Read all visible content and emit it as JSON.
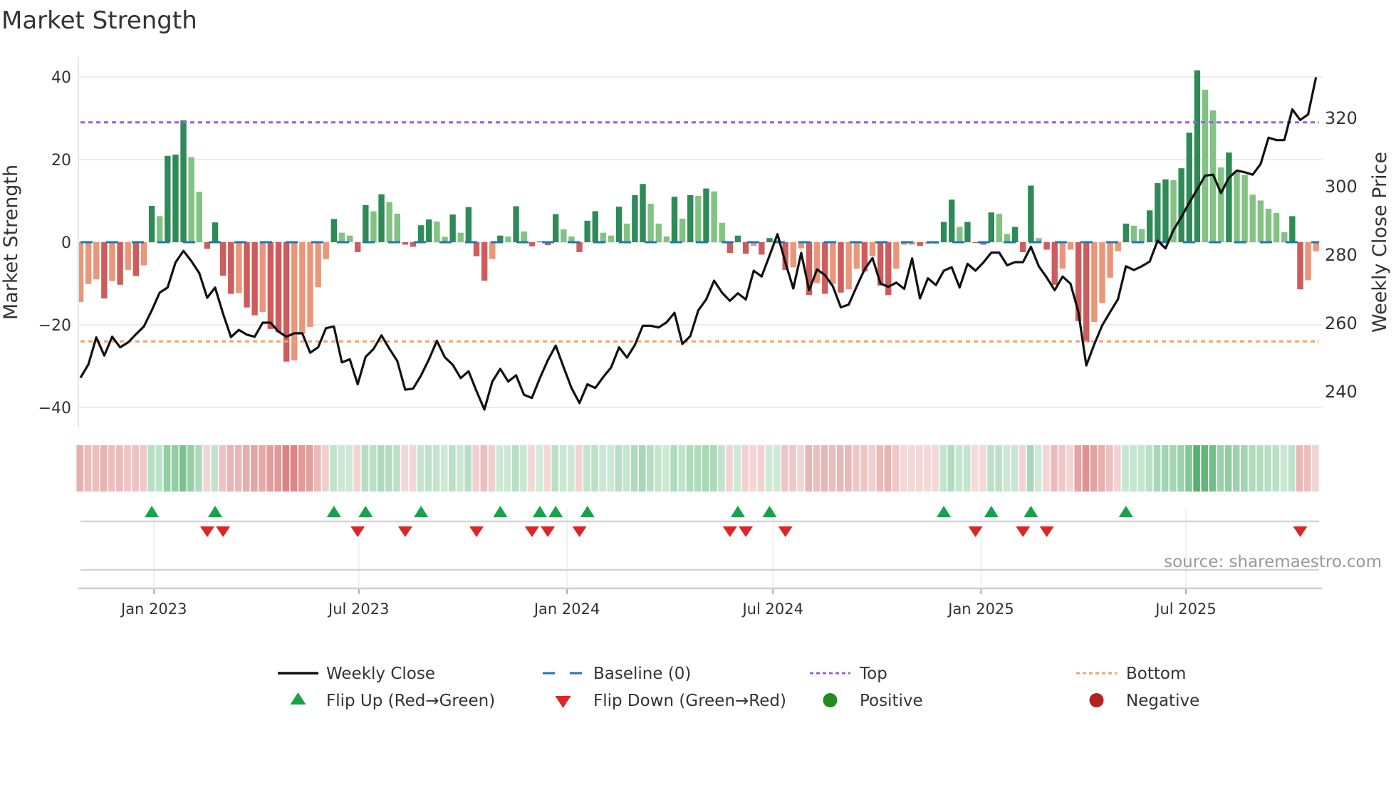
{
  "chart_data": {
    "type": "bar+line",
    "title": "Market Strength",
    "ylabel": "Market Strength",
    "y2label": "Weekly Close Price",
    "ylim": [
      -45,
      45
    ],
    "y2lim": [
      229.4,
      337.7
    ],
    "yticks": [
      {
        "value": 40,
        "label": "40"
      },
      {
        "value": 20,
        "label": "20"
      },
      {
        "value": 0,
        "label": "0"
      },
      {
        "value": -20,
        "label": "−20"
      },
      {
        "value": -40,
        "label": "−40"
      }
    ],
    "y2ticks": [
      {
        "value": 320,
        "label": "320"
      },
      {
        "value": 300,
        "label": "300"
      },
      {
        "value": 280,
        "label": "280"
      },
      {
        "value": 260,
        "label": "260"
      },
      {
        "value": 240,
        "label": "240"
      }
    ],
    "start_date": "2022-10-28",
    "frequency": "weekly",
    "xticks": [
      {
        "date": "2023-01-01",
        "label": "Jan 2023"
      },
      {
        "date": "2023-07-01",
        "label": "Jul 2023"
      },
      {
        "date": "2024-01-01",
        "label": "Jan 2024"
      },
      {
        "date": "2024-07-01",
        "label": "Jul 2024"
      },
      {
        "date": "2025-01-01",
        "label": "Jan 2025"
      },
      {
        "date": "2025-07-01",
        "label": "Jul 2025"
      }
    ],
    "top_level": 29,
    "bottom_level": -24,
    "baseline": 0,
    "strength": [
      -14.5,
      -10.1,
      -9.0,
      -13.6,
      -9.4,
      -10.3,
      -6.7,
      -8.2,
      -5.6,
      8.8,
      6.3,
      20.9,
      21.2,
      29.5,
      20.6,
      12.2,
      -1.6,
      4.8,
      -8.1,
      -12.5,
      -12.3,
      -15.8,
      -17.7,
      -16.9,
      -21.0,
      -21.8,
      -28.9,
      -28.6,
      -22.2,
      -20.5,
      -10.9,
      -4.1,
      5.6,
      2.3,
      1.6,
      -2.4,
      9.0,
      7.5,
      11.6,
      9.7,
      6.9,
      -0.6,
      -1.1,
      4.1,
      5.5,
      5.0,
      1.3,
      6.7,
      2.3,
      8.5,
      -3.4,
      -9.3,
      -4.1,
      1.6,
      1.4,
      8.7,
      2.6,
      -1.0,
      0.2,
      -0.7,
      6.8,
      3.1,
      1.4,
      -2.4,
      5.2,
      7.5,
      2.3,
      1.6,
      8.6,
      4.5,
      11.4,
      14.1,
      9.3,
      4.5,
      1.4,
      11.0,
      5.7,
      11.4,
      11.2,
      13.0,
      12.3,
      4.7,
      -2.6,
      1.6,
      -2.8,
      -0.9,
      -3.0,
      1.0,
      0.5,
      -6.7,
      -6.1,
      -1.5,
      -12.8,
      -9.9,
      -12.5,
      -10.1,
      -12.2,
      -11.4,
      -6.4,
      -7.1,
      -3.4,
      -10.5,
      -12.8,
      -6.4,
      -0.6,
      -0.6,
      -0.9,
      -0.4,
      -0.4,
      4.9,
      10.3,
      3.7,
      4.9,
      -0.2,
      -0.6,
      7.2,
      6.9,
      2.0,
      3.7,
      -2.4,
      13.7,
      1.0,
      -1.8,
      -10.3,
      -6.4,
      -1.8,
      -19.1,
      -24.2,
      -19.3,
      -14.7,
      -8.6,
      -2.2,
      4.5,
      4.0,
      3.2,
      7.7,
      14.3,
      15.2,
      15.0,
      17.9,
      26.5,
      41.6,
      36.9,
      31.9,
      18.1,
      21.7,
      17.2,
      16.3,
      11.5,
      10.1,
      8.1,
      7.1,
      2.4,
      6.3,
      -11.4,
      -9.2,
      -2.2
    ],
    "weekly_close": [
      243.9,
      247.8,
      255.7,
      250.4,
      255.9,
      252.8,
      254.2,
      256.6,
      258.9,
      263.6,
      268.8,
      270.3,
      277.6,
      281.0,
      278.0,
      274.5,
      267.3,
      270.3,
      262.6,
      255.8,
      257.9,
      256.5,
      255.9,
      260.0,
      260.0,
      257.4,
      255.9,
      256.9,
      256.9,
      251.2,
      252.8,
      258.4,
      258.9,
      248.4,
      249.3,
      242.0,
      250.0,
      252.3,
      256.3,
      252.4,
      248.8,
      240.4,
      240.7,
      244.6,
      249.3,
      254.7,
      249.9,
      247.7,
      243.8,
      245.8,
      240.0,
      234.6,
      242.8,
      246.5,
      242.8,
      244.6,
      238.9,
      238.0,
      243.8,
      249.0,
      253.3,
      247.0,
      240.9,
      236.5,
      242.0,
      240.9,
      244.1,
      246.9,
      252.8,
      249.8,
      253.5,
      259.1,
      259.1,
      258.6,
      260.1,
      262.9,
      253.8,
      256.1,
      263.6,
      266.8,
      272.3,
      268.8,
      266.4,
      268.6,
      266.8,
      275.2,
      273.5,
      279.6,
      285.9,
      277.6,
      270.0,
      280.4,
      269.5,
      275.6,
      273.9,
      270.6,
      264.5,
      265.3,
      270.6,
      275.6,
      278.9,
      271.5,
      270.5,
      271.7,
      269.9,
      278.8,
      267.1,
      273.0,
      271.0,
      275.2,
      276.2,
      270.3,
      277.2,
      275.2,
      277.6,
      280.5,
      280.5,
      276.8,
      277.7,
      277.7,
      282.2,
      276.5,
      273.2,
      269.5,
      273.5,
      271.4,
      263.1,
      247.5,
      253.7,
      259.2,
      263.1,
      266.9,
      276.5,
      275.4,
      276.5,
      277.9,
      284.0,
      281.7,
      287.1,
      290.9,
      295.1,
      299.0,
      303.0,
      303.3,
      297.9,
      302.4,
      304.5,
      304.0,
      303.3,
      306.4,
      314.1,
      313.4,
      313.4,
      322.4,
      319.3,
      320.9,
      331.8
    ],
    "legend": {
      "placement": "bottom",
      "items": [
        {
          "key": "close",
          "label": "Weekly Close"
        },
        {
          "key": "baseline",
          "label": "Baseline (0)"
        },
        {
          "key": "top",
          "label": "Top"
        },
        {
          "key": "bottom",
          "label": "Bottom"
        },
        {
          "key": "flip_up",
          "label": "Flip Up (Red→Green)"
        },
        {
          "key": "flip_down",
          "label": "Flip Down (Green→Red)"
        },
        {
          "key": "positive",
          "label": "Positive"
        },
        {
          "key": "negative",
          "label": "Negative"
        }
      ]
    },
    "source": "source: sharemaestro.com",
    "colors": {
      "rise_pos": "#2e8b57",
      "fall_pos": "#82c282",
      "fall_neg": "#cd5c5c",
      "rise_neg": "#e9967a",
      "close": "#111111",
      "baseline": "#1f77b4",
      "top": "#9b5fd8",
      "bottom": "#f0a468",
      "flip_up": "#16a34a",
      "flip_down": "#dc2626",
      "positive": "#228b22",
      "negative": "#b22222"
    }
  }
}
